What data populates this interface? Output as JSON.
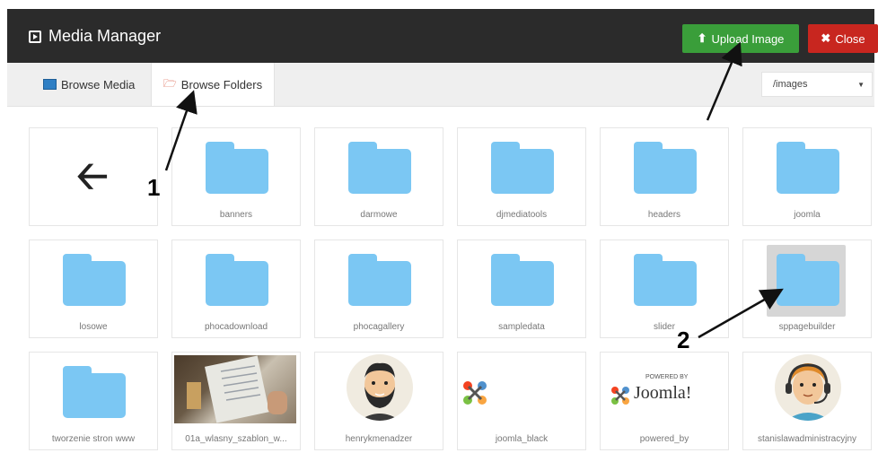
{
  "header": {
    "title": "Media Manager",
    "upload_label": "Upload Image",
    "close_label": "Close"
  },
  "tabs": {
    "browse_media": "Browse Media",
    "browse_folders": "Browse Folders"
  },
  "folder_select": {
    "value": "/images"
  },
  "items": [
    {
      "label": "banners"
    },
    {
      "label": "darmowe"
    },
    {
      "label": "djmediatools"
    },
    {
      "label": "headers"
    },
    {
      "label": "joomla"
    },
    {
      "label": "losowe"
    },
    {
      "label": "phocadownload"
    },
    {
      "label": "phocagallery"
    },
    {
      "label": "sampledata"
    },
    {
      "label": "slider"
    },
    {
      "label": "sppagebuilder"
    },
    {
      "label": "tworzenie stron www"
    },
    {
      "label": "01a_wlasny_szablon_w..."
    },
    {
      "label": "henrykmenadzer"
    },
    {
      "label": "joomla_black"
    },
    {
      "label": "powered_by"
    },
    {
      "label": "stanislawadministracyjny"
    }
  ],
  "powered_logo": {
    "small": "POWERED BY",
    "big": "Joomla!"
  },
  "annotations": {
    "one": "1",
    "two": "2"
  },
  "colors": {
    "header_bg": "#2b2b2b",
    "upload_green": "#3a9e3a",
    "close_red": "#c8261f",
    "folder_blue": "#7bc7f3"
  }
}
